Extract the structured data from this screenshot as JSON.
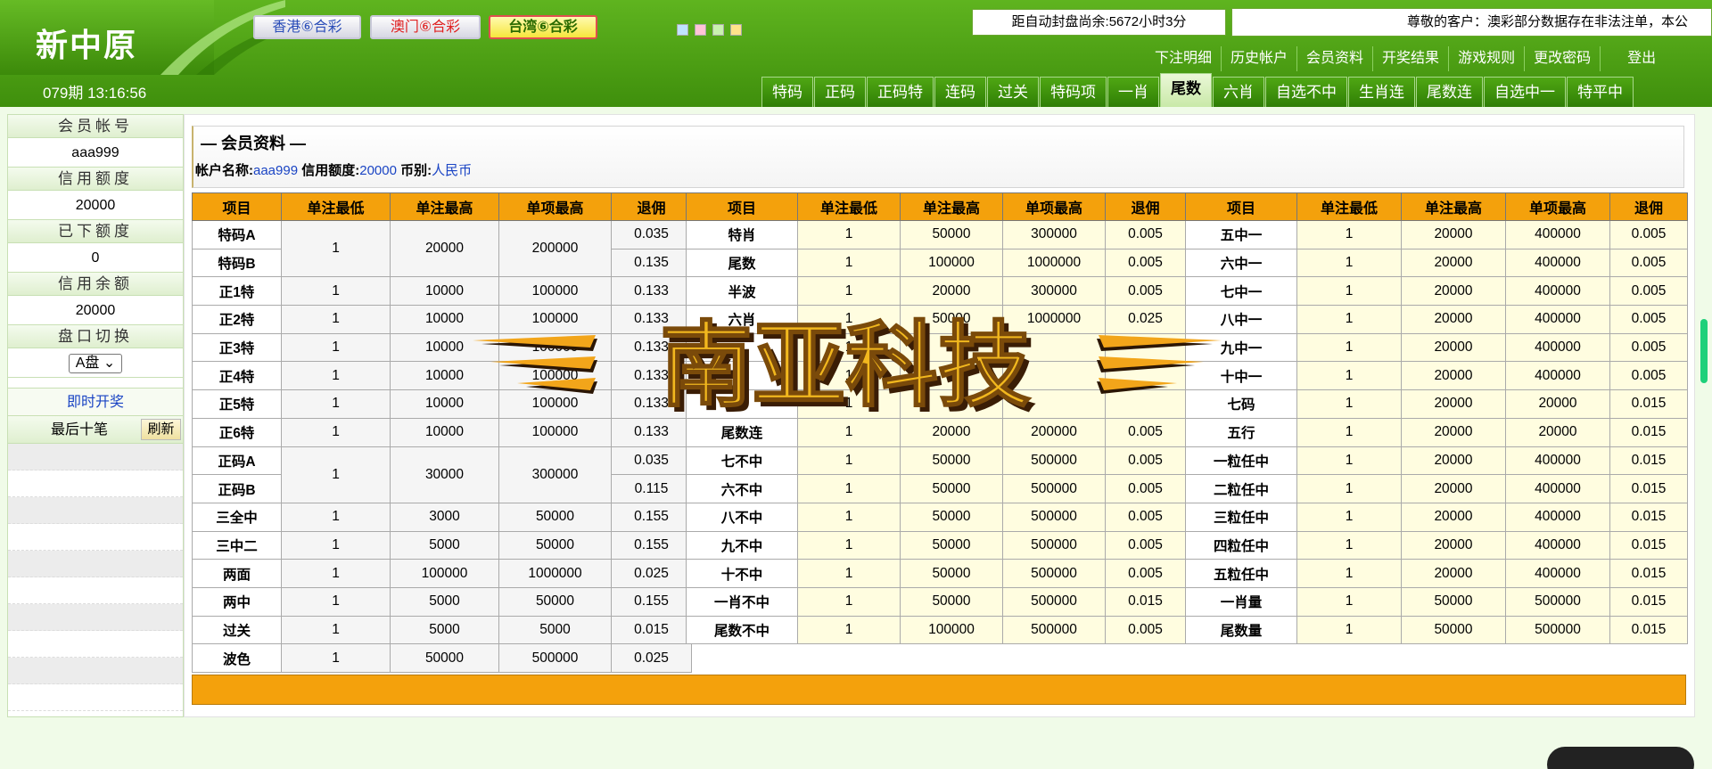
{
  "brand": {
    "title": "新中原"
  },
  "period": "079期 13:16:56",
  "lottery_tabs": [
    {
      "label": "香港⑥合彩"
    },
    {
      "label": "澳门⑥合彩"
    },
    {
      "label": "台湾⑥合彩",
      "active": true
    }
  ],
  "countdown": "距自动封盘尚余:5672小时3分",
  "notice": "尊敬的客户：澳彩部分数据存在非法注单，本公",
  "top_nav": [
    "下注明细",
    "历史帐户",
    "会员资料",
    "开奖结果",
    "游戏规则",
    "更改密码",
    "登出"
  ],
  "game_tabs": [
    {
      "label": "特码"
    },
    {
      "label": "正码"
    },
    {
      "label": "正码特"
    },
    {
      "label": "连码"
    },
    {
      "label": "过关"
    },
    {
      "label": "特码项"
    },
    {
      "label": "一肖"
    },
    {
      "label": "尾数",
      "active": true
    },
    {
      "label": "六肖"
    },
    {
      "label": "自选不中"
    },
    {
      "label": "生肖连"
    },
    {
      "label": "尾数连"
    },
    {
      "label": "自选中一"
    },
    {
      "label": "特平中"
    }
  ],
  "sidebar": {
    "account_label": "会员帐号",
    "account_value": "aaa999",
    "credit_label": "信用额度",
    "credit_value": "20000",
    "placed_label": "已下额度",
    "placed_value": "0",
    "balance_label": "信用余额",
    "balance_value": "20000",
    "plate_label": "盘口切换",
    "plate_value": "A盘",
    "draw_link": "即时开奖",
    "last_ten_label": "最后十笔",
    "refresh_label": "刷新"
  },
  "member": {
    "title": "— 会员资料 —",
    "account_label": "帐户名称:",
    "account_value": "aaa999",
    "credit_label": "信用额度:",
    "credit_value": "20000",
    "currency_label": "币别:",
    "currency_value": "人民币"
  },
  "table_headers": [
    "项目",
    "单注最低",
    "单注最高",
    "单项最高",
    "退佣"
  ],
  "table1_rows": [
    {
      "name": "特码A",
      "min": "1",
      "max": "20000",
      "item_max": "200000",
      "rebate": "0.035"
    },
    {
      "name": "特码B",
      "rebate": "0.135"
    },
    {
      "name": "正1特",
      "min": "1",
      "max": "10000",
      "item_max": "100000",
      "rebate": "0.133"
    },
    {
      "name": "正2特",
      "min": "1",
      "max": "10000",
      "item_max": "100000",
      "rebate": "0.133"
    },
    {
      "name": "正3特",
      "min": "1",
      "max": "10000",
      "item_max": "100000",
      "rebate": "0.133"
    },
    {
      "name": "正4特",
      "min": "1",
      "max": "10000",
      "item_max": "100000",
      "rebate": "0.133"
    },
    {
      "name": "正5特",
      "min": "1",
      "max": "10000",
      "item_max": "100000",
      "rebate": "0.133"
    },
    {
      "name": "正6特",
      "min": "1",
      "max": "10000",
      "item_max": "100000",
      "rebate": "0.133"
    },
    {
      "name": "正码A",
      "min": "1",
      "max": "30000",
      "item_max": "300000",
      "rebate": "0.035"
    },
    {
      "name": "正码B",
      "rebate": "0.115"
    },
    {
      "name": "三全中",
      "min": "1",
      "max": "3000",
      "item_max": "50000",
      "rebate": "0.155"
    },
    {
      "name": "三中二",
      "min": "1",
      "max": "5000",
      "item_max": "50000",
      "rebate": "0.155"
    },
    {
      "name": "两面",
      "min": "1",
      "max": "100000",
      "item_max": "1000000",
      "rebate": "0.025"
    },
    {
      "name": "两中",
      "min": "1",
      "max": "5000",
      "item_max": "50000",
      "rebate": "0.155"
    },
    {
      "name": "过关",
      "min": "1",
      "max": "5000",
      "item_max": "5000",
      "rebate": "0.015"
    },
    {
      "name": "波色",
      "min": "1",
      "max": "50000",
      "item_max": "500000",
      "rebate": "0.025"
    }
  ],
  "table2_rows": [
    {
      "name": "特肖",
      "min": "1",
      "max": "50000",
      "item_max": "300000",
      "rebate": "0.005"
    },
    {
      "name": "尾数",
      "min": "1",
      "max": "100000",
      "item_max": "1000000",
      "rebate": "0.005"
    },
    {
      "name": "半波",
      "min": "1",
      "max": "20000",
      "item_max": "300000",
      "rebate": "0.005"
    },
    {
      "name": "六肖",
      "min": "1",
      "max": "50000",
      "item_max": "1000000",
      "rebate": "0.025"
    },
    {
      "name": "",
      "min": "1",
      "max": "",
      "item_max": "",
      "rebate": ""
    },
    {
      "name": "",
      "min": "1",
      "max": "",
      "item_max": "",
      "rebate": ""
    },
    {
      "name": "",
      "min": "1",
      "max": "",
      "item_max": "",
      "rebate": ""
    },
    {
      "name": "尾数连",
      "min": "1",
      "max": "20000",
      "item_max": "200000",
      "rebate": "0.005"
    },
    {
      "name": "七不中",
      "min": "1",
      "max": "50000",
      "item_max": "500000",
      "rebate": "0.005"
    },
    {
      "name": "六不中",
      "min": "1",
      "max": "50000",
      "item_max": "500000",
      "rebate": "0.005"
    },
    {
      "name": "八不中",
      "min": "1",
      "max": "50000",
      "item_max": "500000",
      "rebate": "0.005"
    },
    {
      "name": "九不中",
      "min": "1",
      "max": "50000",
      "item_max": "500000",
      "rebate": "0.005"
    },
    {
      "name": "十不中",
      "min": "1",
      "max": "50000",
      "item_max": "500000",
      "rebate": "0.005"
    },
    {
      "name": "一肖不中",
      "min": "1",
      "max": "50000",
      "item_max": "500000",
      "rebate": "0.015"
    },
    {
      "name": "尾数不中",
      "min": "1",
      "max": "100000",
      "item_max": "500000",
      "rebate": "0.005"
    }
  ],
  "table3_rows": [
    {
      "name": "五中一",
      "min": "1",
      "max": "20000",
      "item_max": "400000",
      "rebate": "0.005"
    },
    {
      "name": "六中一",
      "min": "1",
      "max": "20000",
      "item_max": "400000",
      "rebate": "0.005"
    },
    {
      "name": "七中一",
      "min": "1",
      "max": "20000",
      "item_max": "400000",
      "rebate": "0.005"
    },
    {
      "name": "八中一",
      "min": "1",
      "max": "20000",
      "item_max": "400000",
      "rebate": "0.005"
    },
    {
      "name": "九中一",
      "min": "1",
      "max": "20000",
      "item_max": "400000",
      "rebate": "0.005"
    },
    {
      "name": "十中一",
      "min": "1",
      "max": "20000",
      "item_max": "400000",
      "rebate": "0.005"
    },
    {
      "name": "七码",
      "min": "1",
      "max": "20000",
      "item_max": "20000",
      "rebate": "0.015"
    },
    {
      "name": "五行",
      "min": "1",
      "max": "20000",
      "item_max": "20000",
      "rebate": "0.015"
    },
    {
      "name": "一粒任中",
      "min": "1",
      "max": "20000",
      "item_max": "400000",
      "rebate": "0.015"
    },
    {
      "name": "二粒任中",
      "min": "1",
      "max": "20000",
      "item_max": "400000",
      "rebate": "0.015"
    },
    {
      "name": "三粒任中",
      "min": "1",
      "max": "20000",
      "item_max": "400000",
      "rebate": "0.015"
    },
    {
      "name": "四粒任中",
      "min": "1",
      "max": "20000",
      "item_max": "400000",
      "rebate": "0.015"
    },
    {
      "name": "五粒任中",
      "min": "1",
      "max": "20000",
      "item_max": "400000",
      "rebate": "0.015"
    },
    {
      "name": "一肖量",
      "min": "1",
      "max": "50000",
      "item_max": "500000",
      "rebate": "0.015"
    },
    {
      "name": "尾数量",
      "min": "1",
      "max": "50000",
      "item_max": "500000",
      "rebate": "0.015"
    }
  ],
  "watermark": {
    "text": "南亚科技",
    "color_main": "#f2b81e",
    "color_shadow": "#3a1d05"
  },
  "colors": {
    "header_green": "#4a9e14",
    "table_header_orange": "#f4a10c",
    "link_blue": "#1a44c4"
  }
}
